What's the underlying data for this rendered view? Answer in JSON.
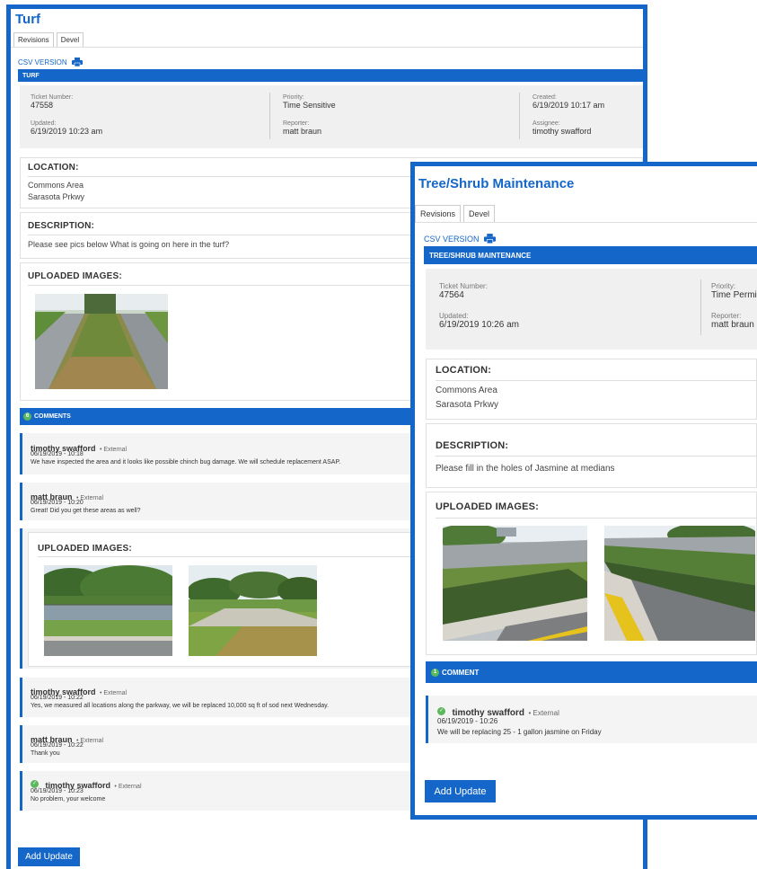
{
  "turf": {
    "title": "Turf",
    "tabs": [
      "Revisions",
      "Devel"
    ],
    "csv_label": "CSV VERSION",
    "header_bar": "TURF",
    "ticket_number_label": "Ticket Number:",
    "ticket_number": "47558",
    "priority_label": "Priority:",
    "priority": "Time Sensitive",
    "created_label": "Created:",
    "created": "6/19/2019 10:17 am",
    "updated_label": "Updated:",
    "updated": "6/19/2019 10:23 am",
    "reporter_label": "Reporter:",
    "reporter": "matt braun",
    "assignee_label": "Assignee:",
    "assignee": "timothy swafford",
    "location_label": "LOCATION:",
    "location_line1": "Commons Area",
    "location_line2": "Sarasota Prkwy",
    "description_label": "DESCRIPTION:",
    "description": "Please see pics below  What is going on here in the turf?",
    "images_label": "UPLOADED IMAGES:",
    "comments_count": "6",
    "comments_label": "COMMENTS",
    "comments": [
      {
        "name": "timothy swafford",
        "source": "• External",
        "date": "06/19/2019 - 10:18",
        "text": "We have inspected the area and it looks like possible chinch bug damage. We will schedule replacement ASAP."
      },
      {
        "name": "matt braun",
        "source": "• External",
        "date": "06/19/2019 - 10:20",
        "text": "Great! Did you get these areas as well?"
      },
      {
        "images_label": "UPLOADED IMAGES:"
      },
      {
        "name": "timothy swafford",
        "source": "• External",
        "date": "06/19/2019 - 10:22",
        "text": "Yes, we measured all locations along the parkway, we will be replaced 10,000 sq ft of sod next Wednesday."
      },
      {
        "name": "matt braun",
        "source": "• External",
        "date": "06/19/2019 - 10:22",
        "text": "Thank you"
      },
      {
        "name": "timothy swafford",
        "source": "• External",
        "date": "06/19/2019 - 10:23",
        "text": "No problem, your welcome"
      }
    ],
    "add_update": "Add Update"
  },
  "tree": {
    "title": "Tree/Shrub Maintenance",
    "tabs": [
      "Revisions",
      "Devel"
    ],
    "csv_label": "CSV VERSION",
    "header_bar": "TREE/SHRUB MAINTENANCE",
    "ticket_number_label": "Ticket Number:",
    "ticket_number": "47564",
    "priority_label": "Priority:",
    "priority": "Time Permi",
    "updated_label": "Updated:",
    "updated": "6/19/2019 10:26 am",
    "reporter_label": "Reporter:",
    "reporter": "matt braun",
    "location_label": "LOCATION:",
    "location_line1": "Commons Area",
    "location_line2": "Sarasota Prkwy",
    "description_label": "DESCRIPTION:",
    "description": "Please fill in the holes of Jasmine at medians",
    "images_label": "UPLOADED IMAGES:",
    "comments_count": "1",
    "comments_label": "COMMENT",
    "comment": {
      "name": "timothy swafford",
      "source": "• External",
      "date": "06/19/2019 - 10:26",
      "text": "We will be replacing 25 - 1 gallon jasmine on Friday"
    },
    "add_update": "Add Update"
  },
  "colors": {
    "accent": "#1466c8",
    "badge": "#5cb85c"
  },
  "icons": [
    "printer-icon",
    "check-badge-icon"
  ]
}
